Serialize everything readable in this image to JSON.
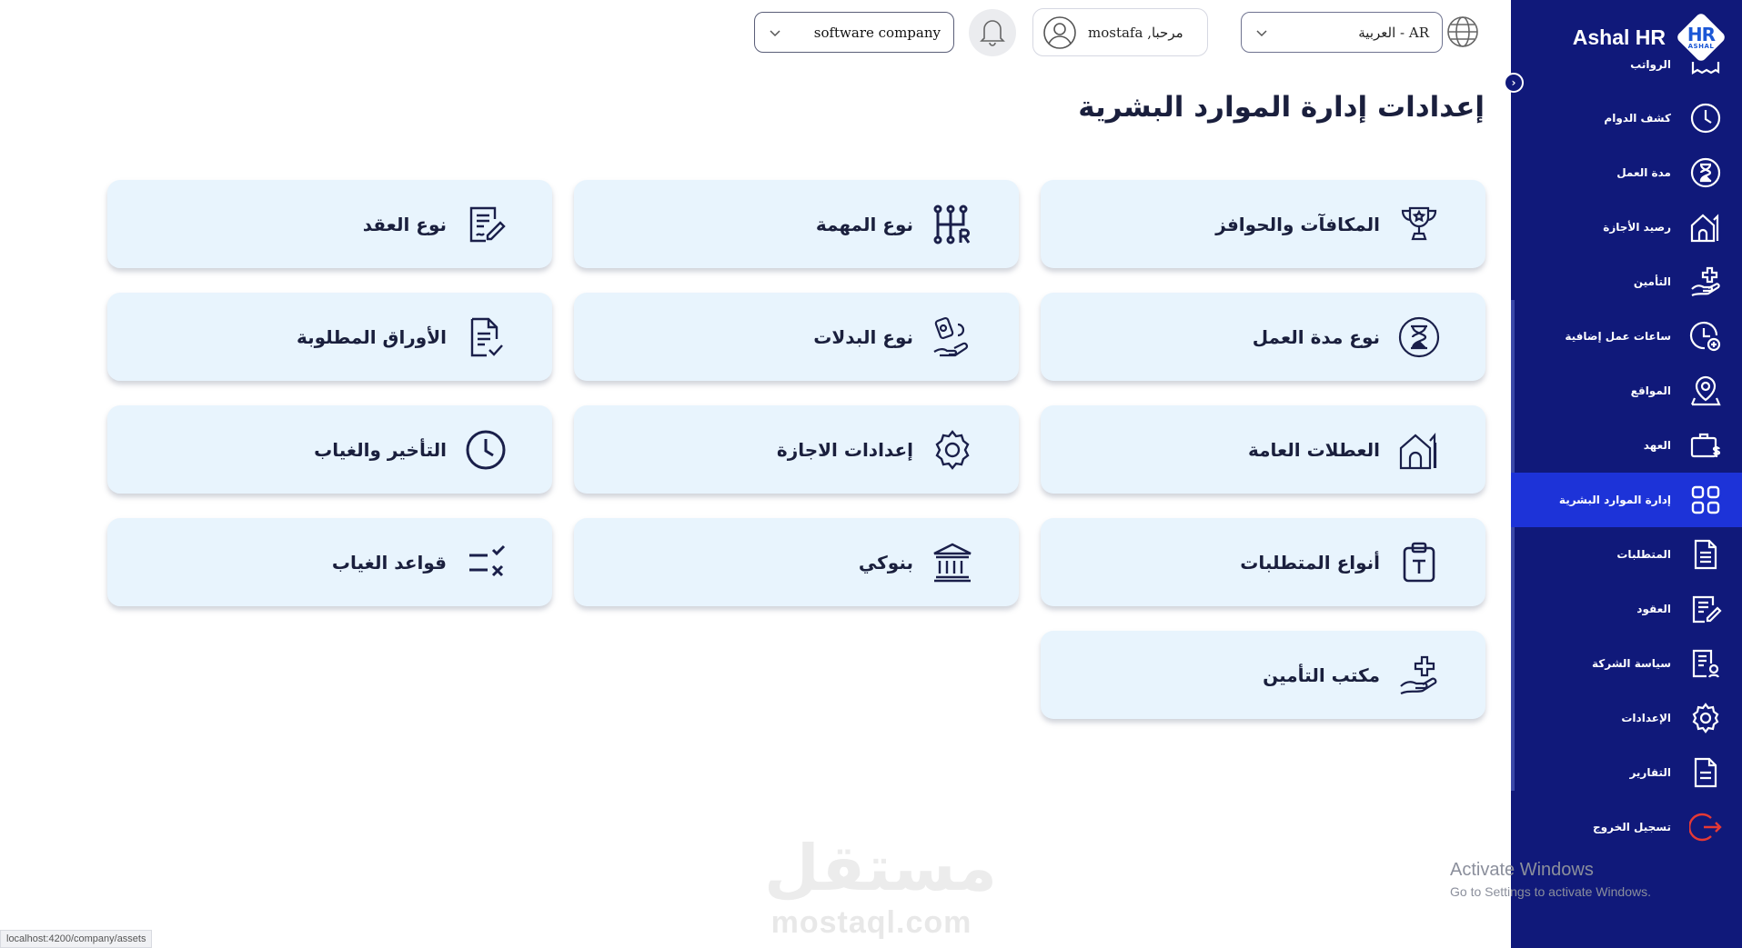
{
  "brand": {
    "name": "Ashal HR",
    "logo_top": "HR",
    "logo_bottom": "ASHAL"
  },
  "topbar": {
    "language": "العربية - AR",
    "greeting": "مرحبا, mostafa",
    "company": "software company"
  },
  "sidebar": {
    "items": [
      {
        "label": "الرواتب",
        "icon": "payroll-icon"
      },
      {
        "label": "كشف الدوام",
        "icon": "clock-icon"
      },
      {
        "label": "مدة العمل",
        "icon": "hourglass-icon"
      },
      {
        "label": "رصيد الأجازة",
        "icon": "house-icon"
      },
      {
        "label": "التأمين",
        "icon": "insurance-hand-icon"
      },
      {
        "label": "ساعات عمل إضافية",
        "icon": "overtime-clock-icon"
      },
      {
        "label": "المواقع",
        "icon": "location-pin-icon"
      },
      {
        "label": "العهد",
        "icon": "briefcase-dollar-icon"
      },
      {
        "label": "إدارة الموارد البشرية",
        "icon": "grid-icon",
        "active": true
      },
      {
        "label": "المتطلبات",
        "icon": "document-list-icon"
      },
      {
        "label": "العقود",
        "icon": "contract-icon"
      },
      {
        "label": "سياسة الشركة",
        "icon": "policy-icon"
      },
      {
        "label": "الإعدادات",
        "icon": "gear-icon"
      },
      {
        "label": "التقارير",
        "icon": "report-icon"
      },
      {
        "label": "تسجيل الخروج",
        "icon": "logout-icon"
      }
    ],
    "accent_active": "#1d33d8",
    "background": "#10197a",
    "logout_color": "#e53935"
  },
  "main": {
    "title": "إعدادات إدارة الموارد البشرية",
    "cards": [
      {
        "label": "المكافآت والحوافز",
        "icon": "trophy-icon"
      },
      {
        "label": "نوع المهمة",
        "icon": "gearshift-icon"
      },
      {
        "label": "نوع العقد",
        "icon": "contract-edit-icon"
      },
      {
        "label": "نوع مدة العمل",
        "icon": "hourglass-icon"
      },
      {
        "label": "نوع البدلات",
        "icon": "allowance-icon"
      },
      {
        "label": "الأوراق المطلوبة",
        "icon": "document-check-icon"
      },
      {
        "label": "العطلات العامة",
        "icon": "holiday-house-icon"
      },
      {
        "label": "إعدادات الاجازة",
        "icon": "gear-icon"
      },
      {
        "label": "التأخير والغياب",
        "icon": "clock-icon"
      },
      {
        "label": "أنواع المتطلبات",
        "icon": "clipboard-text-icon"
      },
      {
        "label": "بنوكي",
        "icon": "bank-icon"
      },
      {
        "label": "قواعد الغياب",
        "icon": "rules-check-icon"
      },
      {
        "label": "مكتب التأمين",
        "icon": "insurance-hand-icon"
      }
    ],
    "card_background": "#e8f4fd"
  },
  "watermark": {
    "arabic": "مستقل",
    "latin": "mostaql.com"
  },
  "os_notice": {
    "title": "Activate Windows",
    "subtitle": "Go to Settings to activate Windows."
  },
  "statusbar": {
    "url": "localhost:4200/company/assets"
  }
}
